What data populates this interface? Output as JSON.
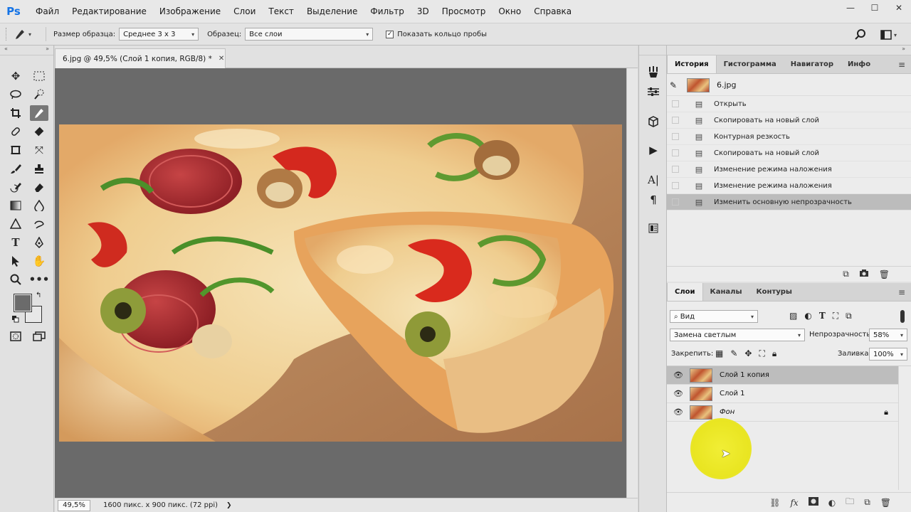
{
  "app": {
    "logo": "Ps",
    "menu": [
      "Файл",
      "Редактирование",
      "Изображение",
      "Слои",
      "Текст",
      "Выделение",
      "Фильтр",
      "3D",
      "Просмотр",
      "Окно",
      "Справка"
    ],
    "window_controls": {
      "minimize": "—",
      "maximize": "☐",
      "close": "✕"
    }
  },
  "options_bar": {
    "sample_size_label": "Размер образца:",
    "sample_size_value": "Среднее 3 х 3",
    "sample_label": "Образец:",
    "sample_value": "Все слои",
    "show_ring_label": "Показать кольцо пробы",
    "show_ring_checked": true
  },
  "document": {
    "tab_title": "6.jpg @ 49,5% (Слой 1 копия, RGB/8) *",
    "zoom": "49,5%",
    "info": "1600 пикс. x 900 пикс. (72 ppi)"
  },
  "history_panel": {
    "tabs": [
      "История",
      "Гистограмма",
      "Навигатор",
      "Инфо"
    ],
    "active_tab": "История",
    "snapshot_name": "6.jpg",
    "steps": [
      "Открыть",
      "Скопировать на новый слой",
      "Контурная резкость",
      "Скопировать на новый слой",
      "Изменение режима наложения",
      "Изменение режима наложения",
      "Изменить основную непрозрачность"
    ],
    "selected_step_index": 6
  },
  "layers_panel": {
    "tabs": [
      "Слои",
      "Каналы",
      "Контуры"
    ],
    "active_tab": "Слои",
    "filter_label": "Вид",
    "blend_mode": "Замена светлым",
    "opacity_label": "Непрозрачность:",
    "opacity_value": "58%",
    "lock_label": "Закрепить:",
    "fill_label": "Заливка:",
    "fill_value": "100%",
    "layers": [
      {
        "name": "Слой 1 копия",
        "visible": true,
        "selected": true,
        "locked": false
      },
      {
        "name": "Слой 1",
        "visible": true,
        "selected": false,
        "locked": false
      },
      {
        "name": "Фон",
        "visible": true,
        "selected": false,
        "locked": true
      }
    ]
  },
  "colors": {
    "highlight": "#f0ec2c",
    "canvas_bg": "#6a6a6a",
    "selected_row": "#bdbdbd"
  }
}
